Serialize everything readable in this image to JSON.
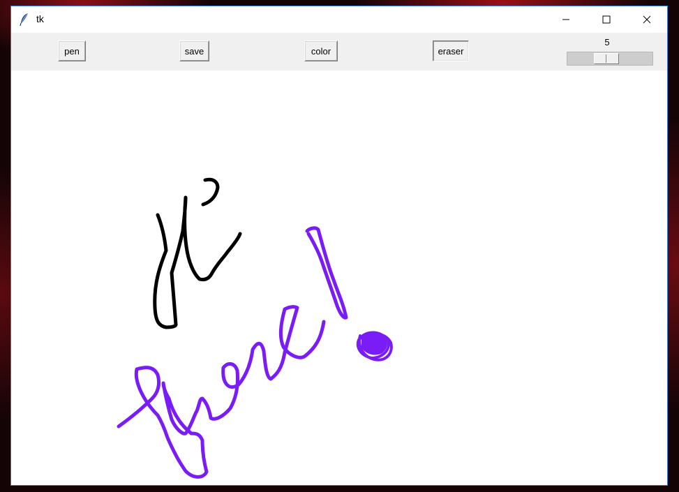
{
  "window": {
    "title": "tk",
    "icons": {
      "app": "feather-icon",
      "minimize": "minimize-icon",
      "maximize": "maximize-icon",
      "close": "close-icon"
    }
  },
  "toolbar": {
    "pen_label": "pen",
    "save_label": "save",
    "color_label": "color",
    "eraser_label": "eraser",
    "active_tool": "eraser",
    "brush_size": {
      "value": 5,
      "label": "5",
      "min": 1,
      "max": 10
    }
  },
  "canvas": {
    "background": "#ffffff",
    "strokes": [
      {
        "name": "hi-stroke",
        "color": "#000000"
      },
      {
        "name": "there-stroke",
        "color": "#7a1cf5"
      },
      {
        "name": "exclamation-stroke",
        "color": "#7a1cf5"
      },
      {
        "name": "dot-stroke",
        "color": "#7a1cf5"
      }
    ]
  },
  "colors": {
    "pen_black": "#000000",
    "pen_purple": "#7a1cf5",
    "window_border": "#3a7bd5",
    "toolbar_bg": "#f0f0f0"
  }
}
